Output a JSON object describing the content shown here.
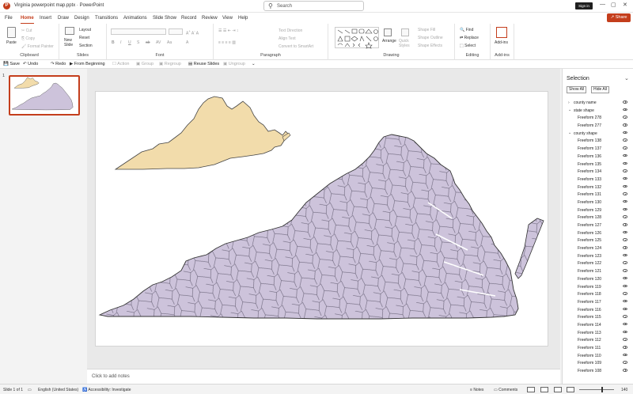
{
  "window": {
    "title": "Virginia powerpoint map.pptx  ·  PowerPoint",
    "app_initial": "P",
    "signin_label": "Sign in",
    "minimize": "—",
    "maximize": "▢",
    "close": "✕"
  },
  "search": {
    "placeholder": "Search"
  },
  "menu": {
    "tabs": [
      "File",
      "Home",
      "Insert",
      "Draw",
      "Design",
      "Transitions",
      "Animations",
      "Slide Show",
      "Record",
      "Review",
      "View",
      "Help"
    ],
    "active": "Home",
    "share_label": "Share"
  },
  "ribbon": {
    "clipboard": {
      "label": "Clipboard",
      "paste": "Paste",
      "cut": "Cut",
      "copy": "Copy",
      "format_painter": "Format Painter"
    },
    "slides": {
      "label": "Slides",
      "new_slide": "New Slide",
      "layout": "Layout",
      "reset": "Reset",
      "section": "Section"
    },
    "font": {
      "label": "Font"
    },
    "paragraph": {
      "label": "Paragraph",
      "text_direction": "Text Direction",
      "align_text": "Align Text",
      "convert_smartart": "Convert to SmartArt"
    },
    "drawing": {
      "label": "Drawing",
      "arrange": "Arrange",
      "quick_styles": "Quick Styles",
      "shape_fill": "Shape Fill",
      "shape_outline": "Shape Outline",
      "shape_effects": "Shape Effects"
    },
    "editing": {
      "label": "Editing",
      "find": "Find",
      "replace": "Replace",
      "select": "Select"
    },
    "addins": {
      "label": "Add-ins",
      "addins": "Add-ins"
    }
  },
  "qat": {
    "save": "Save",
    "undo": "Undo",
    "redo": "Redo",
    "from_beginning": "From Beginning",
    "action": "Action",
    "group": "Group",
    "regroup": "Regroup",
    "reuse_slides": "Reuse Slides",
    "ungroup": "Ungroup"
  },
  "slides_pane": {
    "slide_number": "1"
  },
  "notes": {
    "placeholder": "Click to add notes"
  },
  "selection_pane": {
    "title": "Selection",
    "show_all": "Show All",
    "hide_all": "Hide All",
    "items": [
      {
        "label": "county name",
        "level": 0,
        "expand": "›"
      },
      {
        "label": "state shape",
        "level": 0,
        "expand": "⌄"
      },
      {
        "label": "Freeform 278",
        "level": 1
      },
      {
        "label": "Freeform 277",
        "level": 1
      },
      {
        "label": "county shape",
        "level": 0,
        "expand": "⌄"
      },
      {
        "label": "Freeform 138",
        "level": 1
      },
      {
        "label": "Freeform 137",
        "level": 1
      },
      {
        "label": "Freeform 136",
        "level": 1
      },
      {
        "label": "Freeform 135",
        "level": 1
      },
      {
        "label": "Freeform 134",
        "level": 1
      },
      {
        "label": "Freeform 133",
        "level": 1
      },
      {
        "label": "Freeform 132",
        "level": 1
      },
      {
        "label": "Freeform 131",
        "level": 1
      },
      {
        "label": "Freeform 130",
        "level": 1
      },
      {
        "label": "Freeform 129",
        "level": 1
      },
      {
        "label": "Freeform 128",
        "level": 1
      },
      {
        "label": "Freeform 127",
        "level": 1
      },
      {
        "label": "Freeform 126",
        "level": 1
      },
      {
        "label": "Freeform 125",
        "level": 1
      },
      {
        "label": "Freeform 124",
        "level": 1
      },
      {
        "label": "Freeform 123",
        "level": 1
      },
      {
        "label": "Freeform 122",
        "level": 1
      },
      {
        "label": "Freeform 121",
        "level": 1
      },
      {
        "label": "Freeform 120",
        "level": 1
      },
      {
        "label": "Freeform 119",
        "level": 1
      },
      {
        "label": "Freeform 118",
        "level": 1
      },
      {
        "label": "Freeform 117",
        "level": 1
      },
      {
        "label": "Freeform 116",
        "level": 1
      },
      {
        "label": "Freeform 115",
        "level": 1
      },
      {
        "label": "Freeform 114",
        "level": 1
      },
      {
        "label": "Freeform 113",
        "level": 1
      },
      {
        "label": "Freeform 112",
        "level": 1
      },
      {
        "label": "Freeform 111",
        "level": 1
      },
      {
        "label": "Freeform 110",
        "level": 1
      },
      {
        "label": "Freeform 109",
        "level": 1
      },
      {
        "label": "Freeform 108",
        "level": 1
      }
    ]
  },
  "status": {
    "slide": "Slide 1 of 1",
    "language": "English (United States)",
    "accessibility": "Accessibility: Investigate",
    "notes": "Notes",
    "comments": "Comments",
    "zoom": "140"
  },
  "colors": {
    "accent": "#c43e1c",
    "state_fill": "#f2dcab",
    "county_fill": "#cdc3db",
    "outline": "#3a3a3a"
  }
}
